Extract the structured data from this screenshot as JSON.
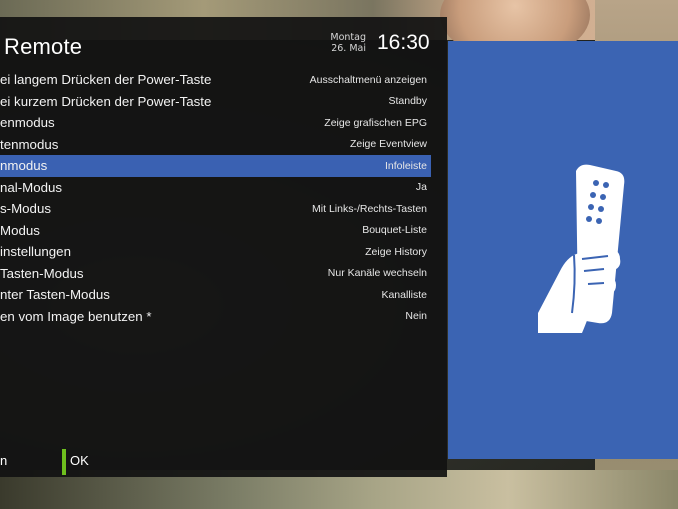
{
  "header": {
    "title": "Remote",
    "date_weekday": "Montag",
    "date_day": "26. Mai",
    "time": "16:30"
  },
  "menu": {
    "selected_index": 4,
    "rows": [
      {
        "label": "ei langem Drücken der Power-Taste",
        "value": "Ausschaltmenü anzeigen"
      },
      {
        "label": "ei kurzem Drücken der Power-Taste",
        "value": "Standby"
      },
      {
        "label": "enmodus",
        "value": "Zeige grafischen EPG"
      },
      {
        "label": "tenmodus",
        "value": "Zeige Eventview"
      },
      {
        "label": "nmodus",
        "value": "Infoleiste"
      },
      {
        "label": "nal-Modus",
        "value": "Ja"
      },
      {
        "label": "s-Modus",
        "value": "Mit Links-/Rechts-Tasten"
      },
      {
        "label": "Modus",
        "value": "Bouquet-Liste"
      },
      {
        "label": "instellungen",
        "value": "Zeige History"
      },
      {
        "label": "Tasten-Modus",
        "value": "Nur Kanäle wechseln"
      },
      {
        "label": "nter Tasten-Modus",
        "value": "Kanalliste"
      },
      {
        "label": "en vom Image benutzen *",
        "value": "Nein"
      }
    ]
  },
  "footer": {
    "left_text": "n",
    "ok_label": "OK"
  },
  "info_panel": {
    "icon": "remote-control-hand-icon",
    "background": "#3b64b3"
  },
  "colors": {
    "selection": "#3a61b2",
    "ok_key": "#6fbf1e"
  }
}
